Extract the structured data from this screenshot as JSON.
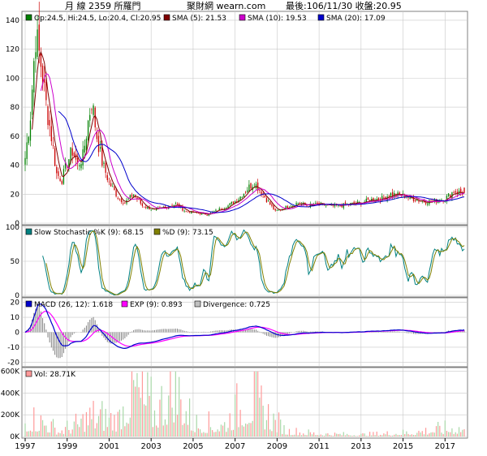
{
  "header": {
    "title": "月 線 2359 所羅門",
    "site": "聚財網 wearn.com",
    "last": "最後:106/11/30 收盤:20.95"
  },
  "colors": {
    "up_candle": "#008000",
    "down_candle": "#cc0000",
    "sma5": "#800000",
    "sma10": "#cc00cc",
    "sma20": "#0000cc",
    "stoch_k": "#008080",
    "stoch_d": "#808000",
    "macd": "#0000cc",
    "exp": "#ff00ff",
    "divergence": "#808080",
    "volume": "#ff9999",
    "grid": "#c8c8c8",
    "panel_bg": "#ffffff"
  },
  "legends": {
    "price": [
      {
        "text": "Op:24.5, Hi:24.5, Lo:20.4, Cl:20.95",
        "color": "#008000"
      },
      {
        "text": "SMA (5): 21.53",
        "color": "#800000"
      },
      {
        "text": "SMA (10): 19.53",
        "color": "#cc00cc"
      },
      {
        "text": "SMA (20): 17.09",
        "color": "#0000cc"
      }
    ],
    "stoch": [
      {
        "text": "Slow Stochastic %K (9): 68.15",
        "color": "#008080"
      },
      {
        "text": "%D (9): 73.15",
        "color": "#808000"
      }
    ],
    "macd": [
      {
        "text": "MACD (26, 12): 1.618",
        "color": "#0000cc"
      },
      {
        "text": "EXP (9): 0.893",
        "color": "#ff00ff"
      },
      {
        "text": "Divergence: 0.725",
        "color": "#c0c0c0"
      }
    ],
    "volume": [
      {
        "text": "Vol: 28.71K",
        "color": "#ff9999"
      }
    ]
  },
  "axes": {
    "price_ticks": [
      "0",
      "20",
      "40",
      "60",
      "80",
      "100",
      "120",
      "140"
    ],
    "stoch_ticks": [
      "0",
      "50",
      "100"
    ],
    "macd_ticks": [
      "-20",
      "-10",
      "0",
      "10",
      "20"
    ],
    "volume_ticks": [
      "0K",
      "200K",
      "400K",
      "600K"
    ],
    "x_ticks": [
      "1997",
      "1999",
      "2001",
      "2003",
      "2005",
      "2007",
      "2009",
      "2011",
      "2013",
      "2015",
      "2017"
    ]
  },
  "chart_data": [
    {
      "type": "candlestick",
      "title": "月 線 2359 所羅門",
      "frequency": "monthly",
      "x_range": [
        "1997-01",
        "2017-11"
      ],
      "ylim": [
        0,
        145
      ],
      "close_anchors": [
        [
          "1997-01",
          45
        ],
        [
          "1997-04",
          75
        ],
        [
          "1997-07",
          130
        ],
        [
          "1997-10",
          110
        ],
        [
          "1998-01",
          82
        ],
        [
          "1998-04",
          60
        ],
        [
          "1998-07",
          34
        ],
        [
          "1998-10",
          30
        ],
        [
          "1999-01",
          42
        ],
        [
          "1999-04",
          50
        ],
        [
          "1999-07",
          40
        ],
        [
          "1999-10",
          46
        ],
        [
          "2000-01",
          70
        ],
        [
          "2000-03",
          85
        ],
        [
          "2000-06",
          60
        ],
        [
          "2000-09",
          42
        ],
        [
          "2001-01",
          28
        ],
        [
          "2001-06",
          18
        ],
        [
          "2001-10",
          14
        ],
        [
          "2002-03",
          20
        ],
        [
          "2002-08",
          12
        ],
        [
          "2003-03",
          9
        ],
        [
          "2003-09",
          11
        ],
        [
          "2004-03",
          13
        ],
        [
          "2004-09",
          8
        ],
        [
          "2005-03",
          7
        ],
        [
          "2005-09",
          6
        ],
        [
          "2006-03",
          9
        ],
        [
          "2006-09",
          12
        ],
        [
          "2007-03",
          17
        ],
        [
          "2007-09",
          25
        ],
        [
          "2007-12",
          28
        ],
        [
          "2008-06",
          18
        ],
        [
          "2008-12",
          8
        ],
        [
          "2009-06",
          11
        ],
        [
          "2010-01",
          14
        ],
        [
          "2010-06",
          12
        ],
        [
          "2011-01",
          13
        ],
        [
          "2011-06",
          12
        ],
        [
          "2012-01",
          12
        ],
        [
          "2012-06",
          13
        ],
        [
          "2013-01",
          14
        ],
        [
          "2013-06",
          16
        ],
        [
          "2014-01",
          17
        ],
        [
          "2014-06",
          20
        ],
        [
          "2015-01",
          19
        ],
        [
          "2015-06",
          17
        ],
        [
          "2016-01",
          15
        ],
        [
          "2016-06",
          15
        ],
        [
          "2017-01",
          17
        ],
        [
          "2017-06",
          22
        ],
        [
          "2017-11",
          20.95
        ]
      ],
      "last_bar": {
        "open": 24.5,
        "high": 24.5,
        "low": 20.4,
        "close": 20.95
      },
      "series": [
        {
          "name": "SMA (5)",
          "last": 21.53
        },
        {
          "name": "SMA (10)",
          "last": 19.53
        },
        {
          "name": "SMA (20)",
          "last": 17.09
        }
      ]
    },
    {
      "type": "line",
      "title": "Slow Stochastic",
      "ylim": [
        0,
        100
      ],
      "series": [
        {
          "name": "Slow Stochastic %K (9)",
          "last": 68.15
        },
        {
          "name": "%D (9)",
          "last": 73.15
        }
      ]
    },
    {
      "type": "line",
      "title": "MACD",
      "ylim": [
        -20,
        20
      ],
      "series": [
        {
          "name": "MACD (26, 12)",
          "last": 1.618
        },
        {
          "name": "EXP (9)",
          "last": 0.893
        },
        {
          "name": "Divergence",
          "last": 0.725
        }
      ]
    },
    {
      "type": "bar",
      "title": "Vol",
      "ylim": [
        0,
        600000
      ],
      "last": "28.71K",
      "volume_anchors": [
        [
          "1997-06",
          180000
        ],
        [
          "1998-01",
          150000
        ],
        [
          "1998-08",
          60000
        ],
        [
          "1999-06",
          120000
        ],
        [
          "2000-03",
          220000
        ],
        [
          "2001-06",
          180000
        ],
        [
          "2002-03",
          560000
        ],
        [
          "2003-03",
          260000
        ],
        [
          "2004-03",
          540000
        ],
        [
          "2005-01",
          140000
        ],
        [
          "2006-06",
          120000
        ],
        [
          "2007-09",
          420000
        ],
        [
          "2008-06",
          260000
        ],
        [
          "2009-06",
          60000
        ],
        [
          "2011-01",
          30000
        ],
        [
          "2013-01",
          20000
        ],
        [
          "2015-01",
          40000
        ],
        [
          "2017-06",
          90000
        ]
      ]
    }
  ]
}
